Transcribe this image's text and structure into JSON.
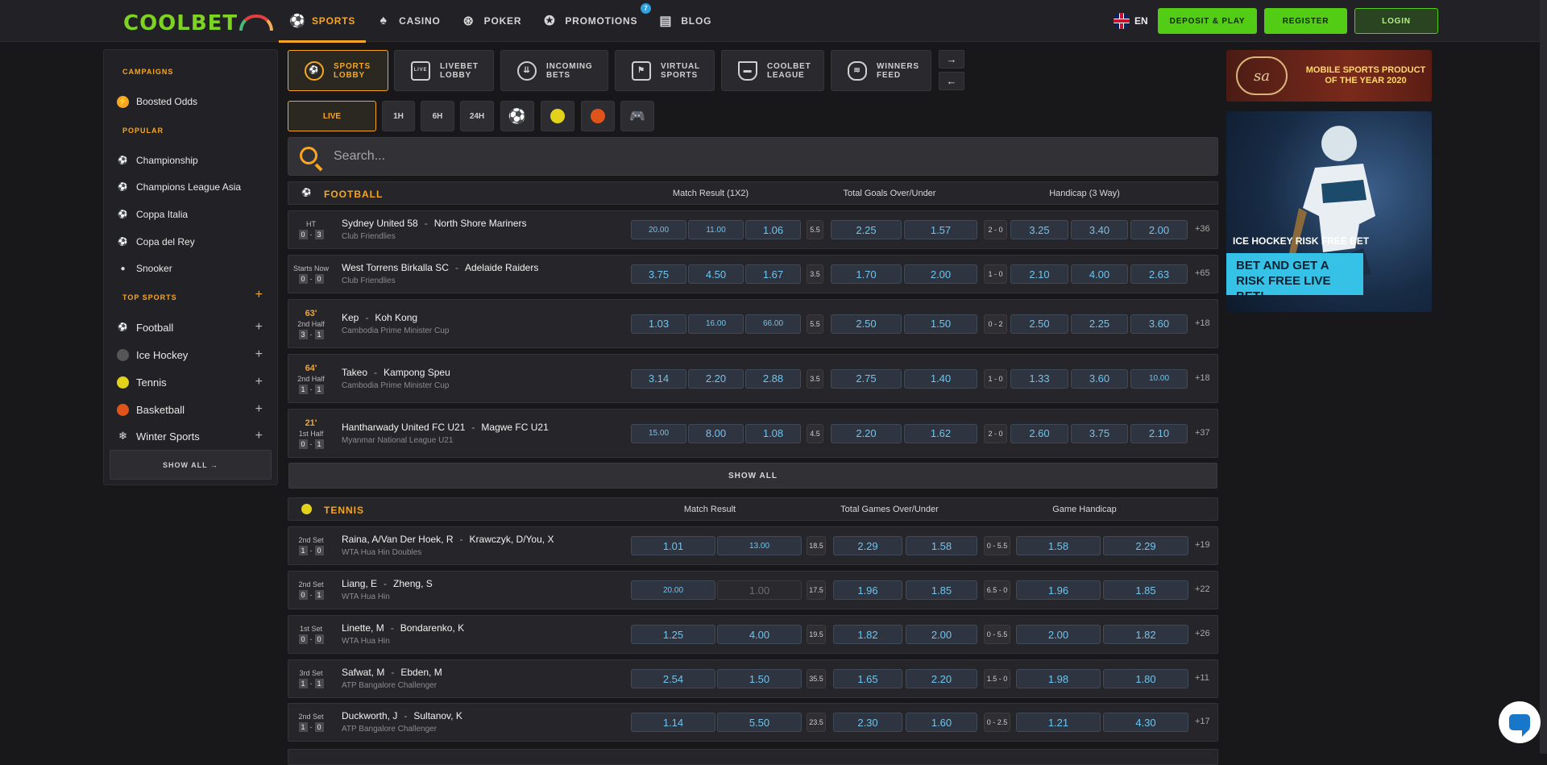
{
  "brand": {
    "logo_text": "COOLBET"
  },
  "nav": [
    {
      "label": "SPORTS",
      "icon": "soccer-ball-icon",
      "active": true
    },
    {
      "label": "CASINO",
      "icon": "casino-icon"
    },
    {
      "label": "POKER",
      "icon": "poker-chip-icon"
    },
    {
      "label": "PROMOTIONS",
      "icon": "star-icon",
      "badge": "7"
    },
    {
      "label": "BLOG",
      "icon": "newspaper-icon"
    }
  ],
  "header": {
    "language": "EN",
    "deposit_label": "DEPOSIT & PLAY",
    "register_label": "REGISTER",
    "login_label": "LOGIN"
  },
  "sidebar": {
    "campaigns_heading": "CAMPAIGNS",
    "campaigns": [
      {
        "label": "Boosted Odds",
        "icon": "lightning-icon"
      }
    ],
    "popular_heading": "POPULAR",
    "popular": [
      {
        "label": "Championship",
        "icon": "soccer-ball-icon"
      },
      {
        "label": "Champions League Asia",
        "icon": "soccer-ball-icon"
      },
      {
        "label": "Coppa Italia",
        "icon": "soccer-ball-icon"
      },
      {
        "label": "Copa del Rey",
        "icon": "soccer-ball-icon"
      },
      {
        "label": "Snooker",
        "icon": "snooker-icon"
      }
    ],
    "top_sports_heading": "TOP SPORTS",
    "top_sports": [
      {
        "label": "Football",
        "icon": "soccer-ball-icon"
      },
      {
        "label": "Ice Hockey",
        "icon": "hockey-puck-icon"
      },
      {
        "label": "Tennis",
        "icon": "tennis-ball-icon"
      },
      {
        "label": "Basketball",
        "icon": "basketball-icon"
      },
      {
        "label": "Winter Sports",
        "icon": "snowflake-icon"
      }
    ],
    "show_all_label": "SHOW ALL →"
  },
  "lobby_tabs": [
    {
      "line1": "SPORTS",
      "line2": "LOBBY",
      "active": true
    },
    {
      "line1": "LIVEBET",
      "line2": "LOBBY"
    },
    {
      "line1": "INCOMING",
      "line2": "BETS"
    },
    {
      "line1": "VIRTUAL",
      "line2": "SPORTS"
    },
    {
      "line1": "COOLBET",
      "line2": "LEAGUE"
    },
    {
      "line1": "WINNERS",
      "line2": "FEED"
    }
  ],
  "tab_arrows": {
    "next": "→",
    "prev": "←"
  },
  "filters": {
    "live": "LIVE",
    "h1": "1H",
    "h6": "6H",
    "h24": "24H"
  },
  "search": {
    "placeholder": "Search..."
  },
  "football": {
    "title": "FOOTBALL",
    "col1": "Match Result (1X2)",
    "col2": "Total Goals Over/Under",
    "col3": "Handicap (3 Way)",
    "show_all": "SHOW ALL",
    "rows": [
      {
        "minute": "",
        "status": "HT",
        "score_home": "0",
        "score_away": "3",
        "home": "Sydney United 58",
        "away": "North Shore Mariners",
        "league": "Club Friendlies",
        "o1": "20.00",
        "ox": "11.00",
        "o2": "1.06",
        "tot_line": "5.5",
        "over": "2.25",
        "under": "1.57",
        "hcp_line": "2 - 0",
        "h1": "3.25",
        "hx": "3.40",
        "h2": "2.00",
        "more": "+36"
      },
      {
        "minute": "",
        "status": "Starts Now",
        "score_home": "0",
        "score_away": "0",
        "home": "West Torrens Birkalla SC",
        "away": "Adelaide Raiders",
        "league": "Club Friendlies",
        "o1": "3.75",
        "ox": "4.50",
        "o2": "1.67",
        "tot_line": "3.5",
        "over": "1.70",
        "under": "2.00",
        "hcp_line": "1 - 0",
        "h1": "2.10",
        "hx": "4.00",
        "h2": "2.63",
        "more": "+65"
      },
      {
        "minute": "63'",
        "status": "2nd Half",
        "score_home": "3",
        "score_away": "1",
        "home": "Kep",
        "away": "Koh Kong",
        "league": "Cambodia Prime Minister Cup",
        "o1": "1.03",
        "ox": "16.00",
        "o2": "66.00",
        "tot_line": "5.5",
        "over": "2.50",
        "under": "1.50",
        "hcp_line": "0 - 2",
        "h1": "2.50",
        "hx": "2.25",
        "h2": "3.60",
        "more": "+18"
      },
      {
        "minute": "64'",
        "status": "2nd Half",
        "score_home": "1",
        "score_away": "1",
        "home": "Takeo",
        "away": "Kampong Speu",
        "league": "Cambodia Prime Minister Cup",
        "o1": "3.14",
        "ox": "2.20",
        "o2": "2.88",
        "tot_line": "3.5",
        "over": "2.75",
        "under": "1.40",
        "hcp_line": "1 - 0",
        "h1": "1.33",
        "hx": "3.60",
        "h2": "10.00",
        "more": "+18"
      },
      {
        "minute": "21'",
        "status": "1st Half",
        "score_home": "0",
        "score_away": "1",
        "home": "Hantharwady United FC U21",
        "away": "Magwe FC U21",
        "league": "Myanmar National League U21",
        "o1": "15.00",
        "ox": "8.00",
        "o2": "1.08",
        "tot_line": "4.5",
        "over": "2.20",
        "under": "1.62",
        "hcp_line": "2 - 0",
        "h1": "2.60",
        "hx": "3.75",
        "h2": "2.10",
        "more": "+37"
      }
    ]
  },
  "tennis": {
    "title": "TENNIS",
    "col1": "Match Result",
    "col2": "Total Games Over/Under",
    "col3": "Game Handicap",
    "rows": [
      {
        "status": "2nd Set",
        "score_home": "1",
        "score_away": "0",
        "home": "Raina, A/Van Der Hoek, R",
        "away": "Krawczyk, D/You, X",
        "league": "WTA Hua Hin Doubles",
        "o1": "1.01",
        "o2": "13.00",
        "tot_line": "18.5",
        "over": "2.29",
        "under": "1.58",
        "hcp_line": "0 - 5.5",
        "h1": "1.58",
        "h2": "2.29",
        "more": "+19"
      },
      {
        "status": "2nd Set",
        "score_home": "0",
        "score_away": "1",
        "home": "Liang, E",
        "away": "Zheng, S",
        "league": "WTA Hua Hin",
        "o1": "20.00",
        "o2": "1.00",
        "tot_line": "17.5",
        "over": "1.96",
        "under": "1.85",
        "hcp_line": "6.5 - 0",
        "h1": "1.96",
        "h2": "1.85",
        "more": "+22"
      },
      {
        "status": "1st Set",
        "score_home": "0",
        "score_away": "0",
        "home": "Linette, M",
        "away": "Bondarenko, K",
        "league": "WTA Hua Hin",
        "o1": "1.25",
        "o2": "4.00",
        "tot_line": "19.5",
        "over": "1.82",
        "under": "2.00",
        "hcp_line": "0 - 5.5",
        "h1": "2.00",
        "h2": "1.82",
        "more": "+26"
      },
      {
        "status": "3rd Set",
        "score_home": "1",
        "score_away": "1",
        "home": "Safwat, M",
        "away": "Ebden, M",
        "league": "ATP Bangalore Challenger",
        "o1": "2.54",
        "o2": "1.50",
        "tot_line": "35.5",
        "over": "1.65",
        "under": "2.20",
        "hcp_line": "1.5 - 0",
        "h1": "1.98",
        "h2": "1.80",
        "more": "+11"
      },
      {
        "status": "2nd Set",
        "score_home": "1",
        "score_away": "0",
        "home": "Duckworth, J",
        "away": "Sultanov, K",
        "league": "ATP Bangalore Challenger",
        "o1": "1.14",
        "o2": "5.50",
        "tot_line": "23.5",
        "over": "2.30",
        "under": "1.60",
        "hcp_line": "0 - 2.5",
        "h1": "1.21",
        "h2": "4.30",
        "more": "+17"
      }
    ]
  },
  "banners": {
    "award_logo": "sa",
    "award_text": "MOBILE SPORTS PRODUCT OF THE YEAR 2020",
    "hockey_title": "ICE HOCKEY RISK FREE BET",
    "hockey_cta": "BET AND GET A RISK FREE LIVE BET!"
  },
  "colors": {
    "accent": "#f6a623",
    "brand_green": "#52cc14",
    "odds_text": "#6fc5ee",
    "background": "#18181b"
  }
}
